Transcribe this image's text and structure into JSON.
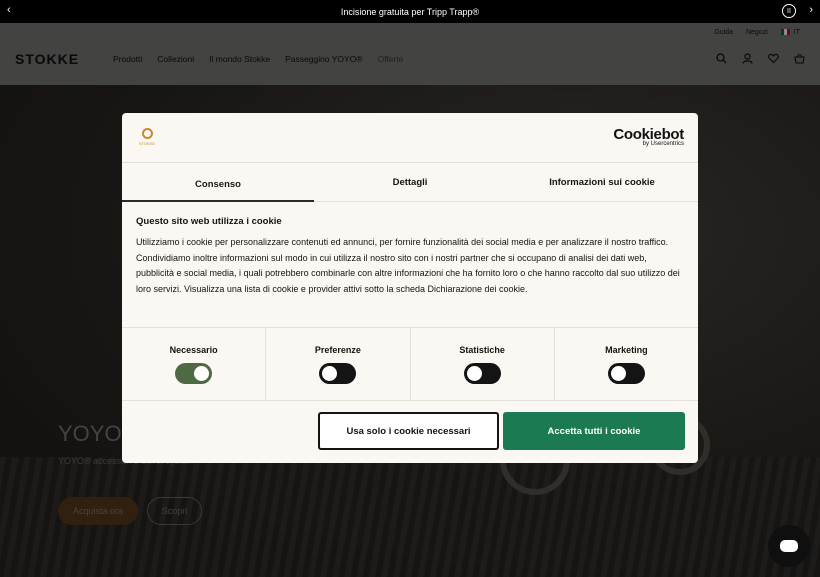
{
  "announcement": {
    "text": "Incisione gratuita per Tripp Trapp®",
    "prev": "‹",
    "next": "›",
    "pause": "II"
  },
  "header": {
    "logo": "STOKKE",
    "utility": [
      "Guida",
      "Negozi"
    ],
    "language": "IT",
    "nav": [
      "Prodotti",
      "Collezioni",
      "Il mondo Stokke",
      "Passeggino YOYO®",
      "Offerte"
    ],
    "icons": [
      "search-icon",
      "user-icon",
      "heart-icon",
      "cart-icon"
    ]
  },
  "hero": {
    "title": "YOYO®",
    "subtitle": "YOYO® accessori e travel system",
    "buy_label": "Acquista ora",
    "discover_label": "Scopri"
  },
  "cookie_dialog": {
    "brand_small": "STOKKE",
    "cookiebot_main": "Cookiebot",
    "cookiebot_sub": "by Usercentrics",
    "tabs": [
      {
        "label": "Consenso",
        "active": true
      },
      {
        "label": "Dettagli",
        "active": false
      },
      {
        "label": "Informazioni sui cookie",
        "active": false
      }
    ],
    "heading": "Questo sito web utilizza i cookie",
    "body": "Utilizziamo i cookie per personalizzare contenuti ed annunci, per fornire funzionalità dei social media e per analizzare il nostro traffico. Condividiamo inoltre informazioni sul modo in cui utilizza il nostro sito con i nostri partner che si occupano di analisi dei dati web, pubblicità e social media, i quali potrebbero combinarle con altre informazioni che ha fornito loro o che hanno raccolto dal suo utilizzo dei loro servizi.  Visualizza una lista di cookie e provider attivi sotto la scheda Dichiarazione dei cookie.",
    "categories": [
      {
        "label": "Necessario",
        "enabled": true
      },
      {
        "label": "Preferenze",
        "enabled": false
      },
      {
        "label": "Statistiche",
        "enabled": false
      },
      {
        "label": "Marketing",
        "enabled": false
      }
    ],
    "necessary_button": "Usa solo i cookie necessari",
    "accept_button": "Accetta tutti i cookie",
    "accent": "#1b7a52"
  }
}
